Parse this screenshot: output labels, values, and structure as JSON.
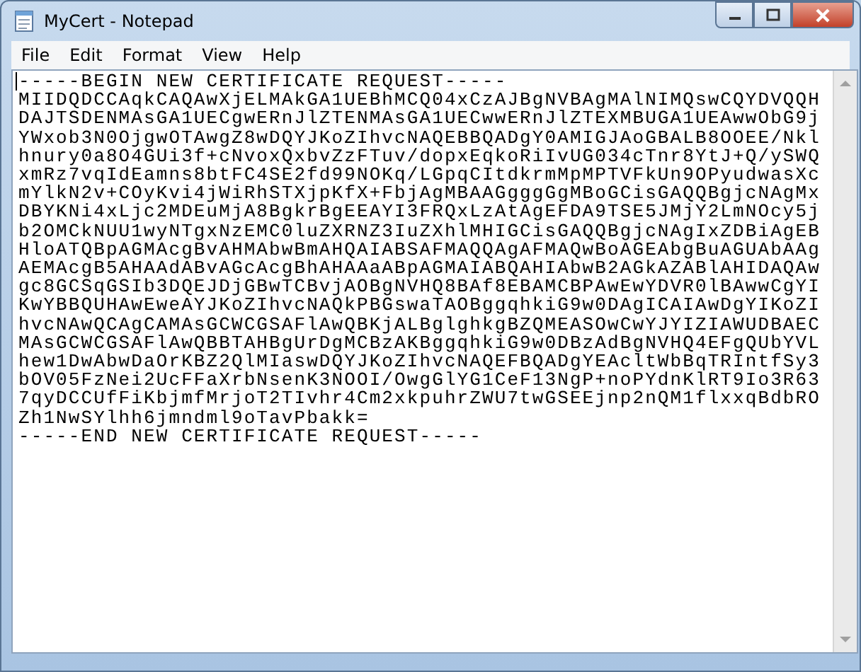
{
  "window": {
    "title": "MyCert - Notepad"
  },
  "menu": [
    "File",
    "Edit",
    "Format",
    "View",
    "Help"
  ],
  "document": {
    "lines": [
      "-----BEGIN NEW CERTIFICATE REQUEST-----",
      "MIIDQDCCAqkCAQAwXjELMAkGA1UEBhMCQ04xCzAJBgNVBAgMAlNIMQswCQYDVQQH",
      "DAJTSDENMAsGA1UECgwERnJlZTENMAsGA1UECwwERnJlZTEXMBUGA1UEAwwObG9j",
      "YWxob3N0OjgwOTAwgZ8wDQYJKoZIhvcNAQEBBQADgY0AMIGJAoGBALB8OOEE/Nkl",
      "hnury0a8O4GUi3f+cNvoxQxbvZzFTuv/dopxEqkoRiIvUG034cTnr8YtJ+Q/ySWQ",
      "xmRz7vqIdEamns8btFC4SE2fd99NOKq/LGpqCItdkrmMpMPTVFkUn9OPyudwasXc",
      "mYlkN2v+COyKvi4jWiRhSTXjpKfX+FbjAgMBAAGgggGgMBoGCisGAQQBgjcNAgMx",
      "DBYKNi4xLjc2MDEuMjA8BgkrBgEEAYI3FRQxLzAtAgEFDA9TSE5JMjY2LmNOcy5j",
      "b2OMCkNUU1wyNTgxNzEMC0luZXRNZ3IuZXhlMHIGCisGAQQBgjcNAgIxZDBiAgEB",
      "HloATQBpAGMAcgBvAHMAbwBmAHQAIABSAFMAQQAgAFMAQwBoAGEAbgBuAGUAbAAg",
      "AEMAcgB5AHAAdABvAGcAcgBhAHAAaABpAGMAIABQAHIAbwB2AGkAZABlAHIDAQAw",
      "gc8GCSqGSIb3DQEJDjGBwTCBvjAOBgNVHQ8BAf8EBAMCBPAwEwYDVR0lBAwwCgYI",
      "KwYBBQUHAwEweAYJKoZIhvcNAQkPBGswaTAOBggqhkiG9w0DAgICAIAwDgYIKoZI",
      "hvcNAwQCAgCAMAsGCWCGSAFlAwQBKjALBglghkgBZQMEASOwCwYJYIZIAWUDBAEC",
      "MAsGCWCGSAFlAwQBBTAHBgUrDgMCBzAKBggqhkiG9w0DBzAdBgNVHQ4EFgQUbYVL",
      "hew1DwAbwDaOrKBZ2QlMIaswDQYJKoZIhvcNAQEFBQADgYEAcltWbBqTRIntfSy3",
      "bOV05FzNei2UcFFaXrbNsenK3NOOI/OwgGlYG1CeF13NgP+noPYdnKlRT9Io3R63",
      "7qyDCCUfFiKbjmfMrjoT2TIvhr4Cm2xkpuhrZWU7twGSEEjnp2nQM1flxxqBdbRO",
      "Zh1NwSYlhh6jmndml9oTavPbakk=",
      "-----END NEW CERTIFICATE REQUEST-----"
    ]
  }
}
